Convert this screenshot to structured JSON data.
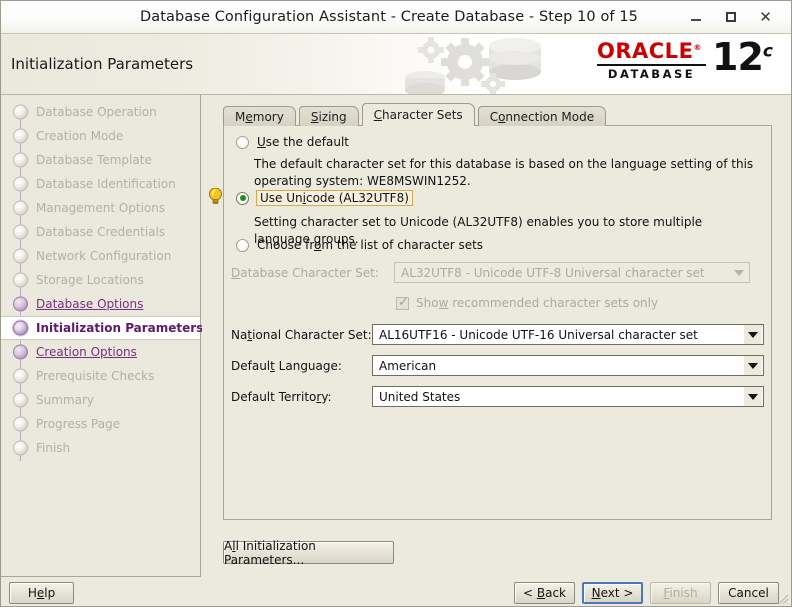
{
  "window": {
    "title": "Database Configuration Assistant - Create Database - Step 10 of 15",
    "minimize_label": "_",
    "maximize_label": "□",
    "close_label": "✕"
  },
  "header": {
    "page_title": "Initialization Parameters",
    "brand": "ORACLE",
    "brand_trademark": "®",
    "brand_sub": "DATABASE",
    "version_number": "12",
    "version_suffix": "c"
  },
  "sidebar": {
    "items": [
      {
        "label": "Database Operation",
        "state": "pending"
      },
      {
        "label": "Creation Mode",
        "state": "pending"
      },
      {
        "label": "Database Template",
        "state": "pending"
      },
      {
        "label": "Database Identification",
        "state": "pending"
      },
      {
        "label": "Management Options",
        "state": "pending"
      },
      {
        "label": "Database Credentials",
        "state": "pending"
      },
      {
        "label": "Network Configuration",
        "state": "pending"
      },
      {
        "label": "Storage Locations",
        "state": "pending"
      },
      {
        "label": "Database Options",
        "state": "done"
      },
      {
        "label": "Initialization Parameters",
        "state": "current"
      },
      {
        "label": "Creation Options",
        "state": "done"
      },
      {
        "label": "Prerequisite Checks",
        "state": "pending"
      },
      {
        "label": "Summary",
        "state": "pending"
      },
      {
        "label": "Progress Page",
        "state": "pending"
      },
      {
        "label": "Finish",
        "state": "pending"
      }
    ]
  },
  "tabs": [
    {
      "label": "Memory",
      "mnemonic_index": 1,
      "active": false
    },
    {
      "label": "Sizing",
      "mnemonic_index": 0,
      "active": false
    },
    {
      "label": "Character Sets",
      "mnemonic_index": 0,
      "active": true
    },
    {
      "label": "Connection Mode",
      "mnemonic_index": 1,
      "active": false
    }
  ],
  "character_sets": {
    "option_default": {
      "label": "Use the default",
      "selected": false,
      "description": "The default character set for this database is based on the language setting of this operating system: WE8MSWIN1252."
    },
    "option_unicode": {
      "label": "Use Unicode (AL32UTF8)",
      "selected": true,
      "focused": true,
      "description": "Setting character set to Unicode (AL32UTF8) enables you to store multiple language groups.",
      "hint_icon": "lightbulb-icon"
    },
    "option_choose": {
      "label": "Choose from the list of character sets",
      "selected": false
    },
    "database_character_set": {
      "label": "Database Character Set:",
      "value": "AL32UTF8 - Unicode UTF-8 Universal character set",
      "disabled": true
    },
    "show_recommended": {
      "label": "Show recommended character sets only",
      "checked": true,
      "disabled": true
    },
    "national_character_set": {
      "label": "National Character Set:",
      "value": "AL16UTF16 - Unicode UTF-16 Universal character set",
      "disabled": false
    },
    "default_language": {
      "label": "Default Language:",
      "value": "American",
      "disabled": false
    },
    "default_territory": {
      "label": "Default Territory:",
      "value": "United States",
      "disabled": false
    }
  },
  "buttons": {
    "all_init_params": "All Initialization Parameters...",
    "help": "Help",
    "back": "< Back",
    "next": "Next >",
    "finish": "Finish",
    "cancel": "Cancel"
  },
  "colors": {
    "window_bg": "#ece9dd",
    "oracle_red": "#ce0000",
    "link_purple": "#7a2f7d",
    "current_purple": "#5f1a6b",
    "focus_blue": "#4a78c2",
    "focus_gold": "#d9a84a",
    "radio_green": "#1f8a1f"
  }
}
